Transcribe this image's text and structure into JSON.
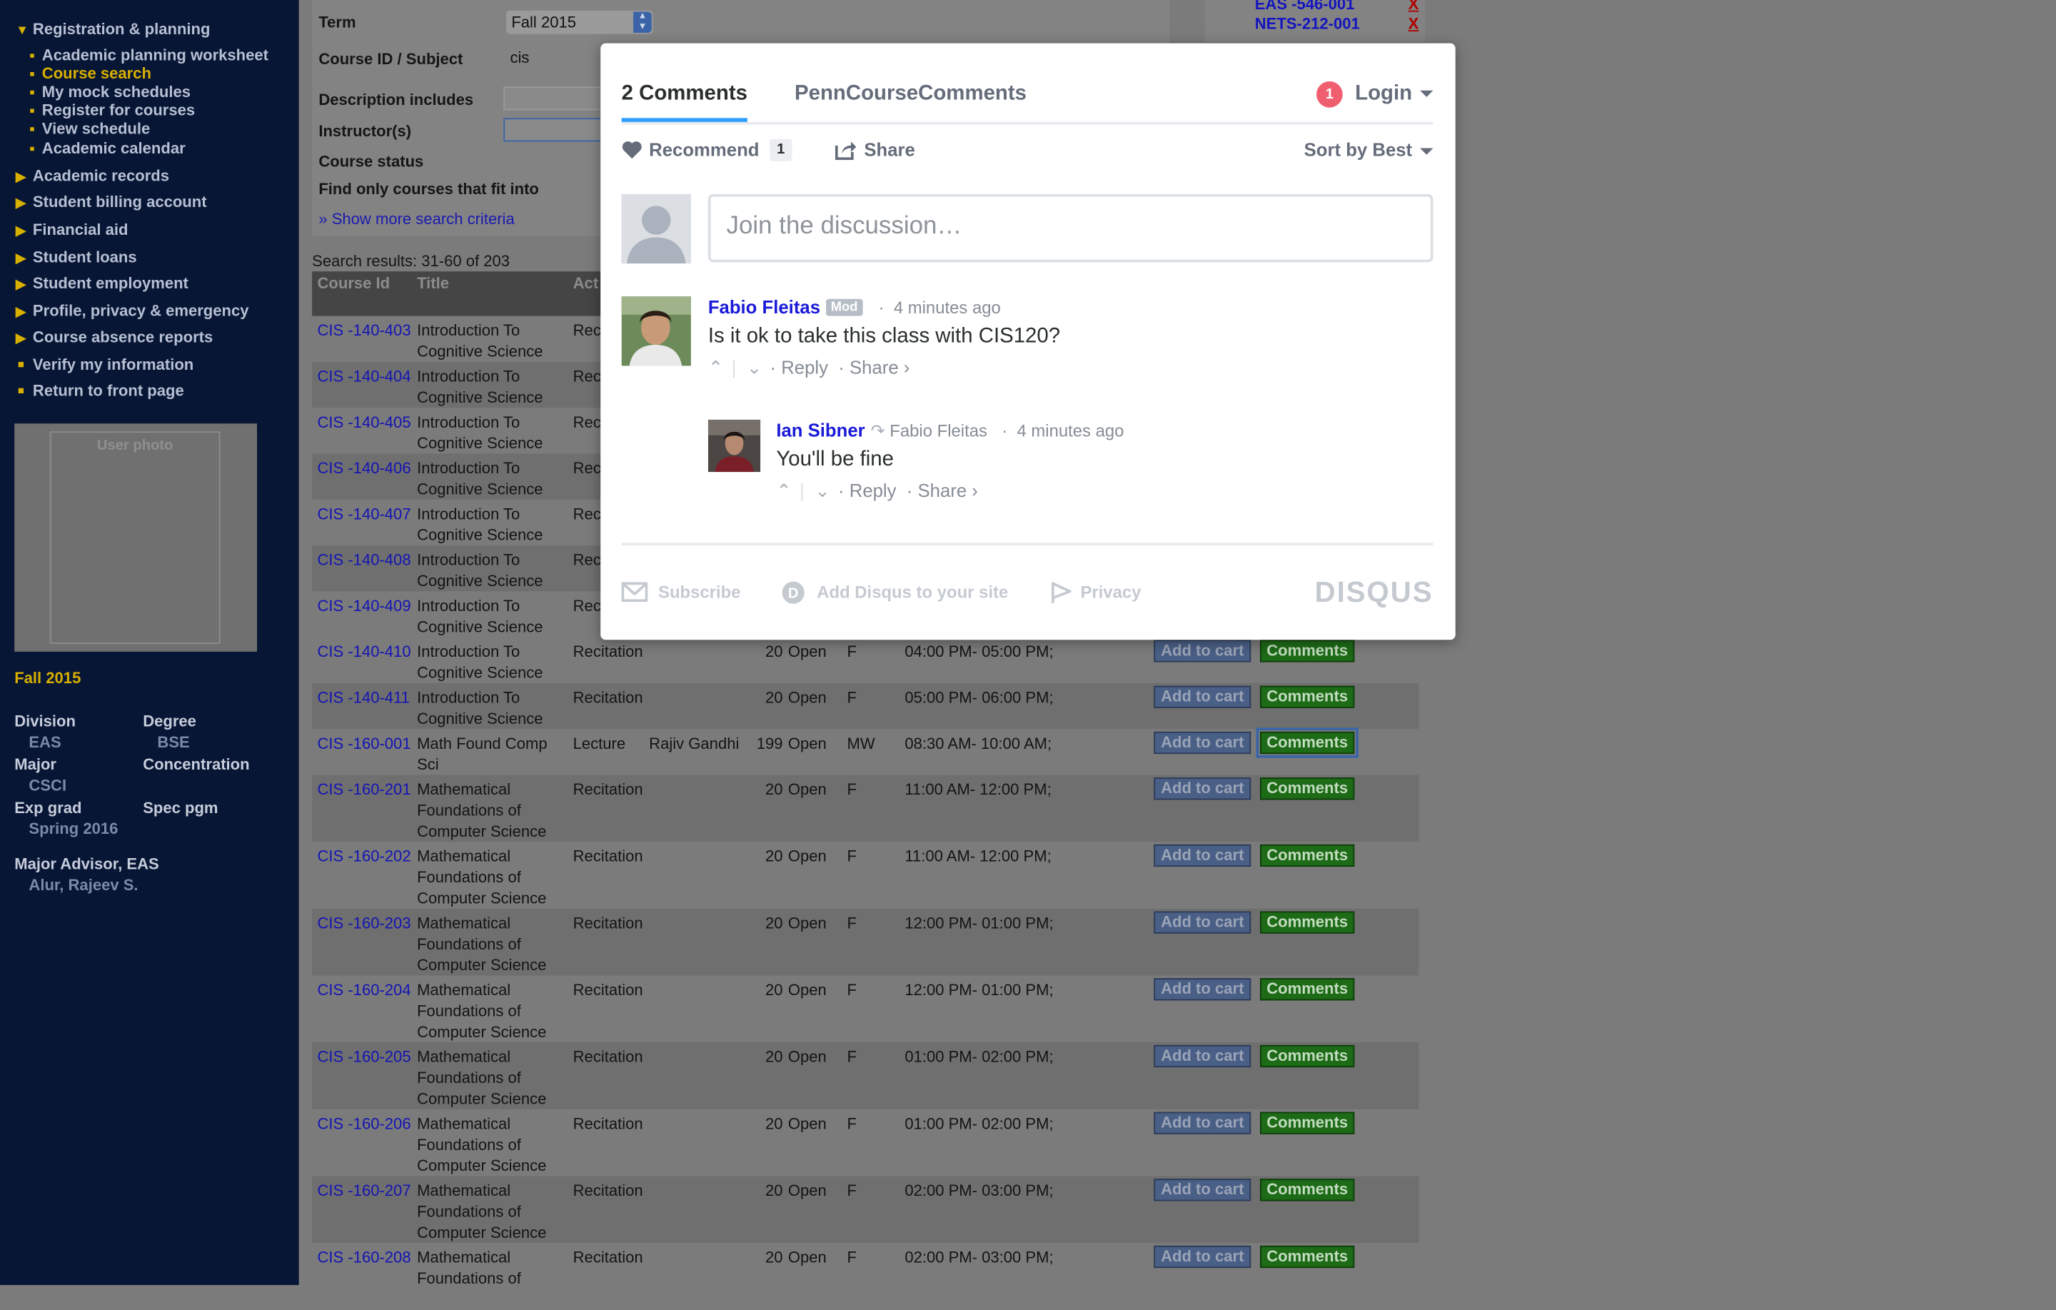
{
  "sidebar": {
    "section_open": "Registration & planning",
    "sub_items": [
      {
        "label": "Academic planning worksheet",
        "active": false
      },
      {
        "label": "Course search",
        "active": true
      },
      {
        "label": "My mock schedules",
        "active": false
      },
      {
        "label": "Register for courses",
        "active": false
      },
      {
        "label": "View schedule",
        "active": false
      },
      {
        "label": "Academic calendar",
        "active": false
      }
    ],
    "sections": [
      {
        "label": "Academic records",
        "marker": "triangle"
      },
      {
        "label": "Student billing account",
        "marker": "triangle"
      },
      {
        "label": "Financial aid",
        "marker": "triangle"
      },
      {
        "label": "Student loans",
        "marker": "triangle"
      },
      {
        "label": "Student employment",
        "marker": "triangle"
      },
      {
        "label": "Profile, privacy & emergency",
        "marker": "triangle"
      },
      {
        "label": "Course absence reports",
        "marker": "triangle"
      },
      {
        "label": "Verify my information",
        "marker": "square"
      },
      {
        "label": "Return to front page",
        "marker": "square"
      }
    ],
    "photo_label": "User photo",
    "semester": "Fall 2015",
    "info": {
      "division_label": "Division",
      "division": "EAS",
      "degree_label": "Degree",
      "degree": "BSE",
      "major_label": "Major",
      "major": "CSCI",
      "concentration_label": "Concentration",
      "exp_grad_label": "Exp grad",
      "exp_grad": "Spring 2016",
      "spec_pgm_label": "Spec pgm",
      "advisor_label": "Major Advisor, EAS",
      "advisor": "Alur, Rajeev S."
    }
  },
  "search_form": {
    "term_label": "Term",
    "term_value": "Fall 2015",
    "course_id_label": "Course ID / Subject",
    "course_id_value": "cis",
    "description_label": "Description includes",
    "instructor_label": "Instructor(s)",
    "status_label": "Course status",
    "fit_label": "Find only courses that fit into",
    "show_more": "» Show more search criteria"
  },
  "cart": [
    {
      "course": "EAS -546-001",
      "remove": "X"
    },
    {
      "course": "NETS-212-001",
      "remove": "X"
    }
  ],
  "results": {
    "summary": "Search results: 31-60 of 203",
    "headers": {
      "course_id": "Course Id",
      "title": "Title",
      "activity": "Act"
    },
    "add_label": "Add to cart",
    "comments_label": "Comments",
    "rows": [
      {
        "id": "CIS -140-403",
        "title": "Introduction To Cognitive Science",
        "activity": "Reci",
        "instructor": "",
        "max": "",
        "status": "",
        "days": "",
        "time": ""
      },
      {
        "id": "CIS -140-404",
        "title": "Introduction To Cognitive Science",
        "activity": "Reci",
        "instructor": "",
        "max": "",
        "status": "",
        "days": "",
        "time": ""
      },
      {
        "id": "CIS -140-405",
        "title": "Introduction To Cognitive Science",
        "activity": "Reci",
        "instructor": "",
        "max": "",
        "status": "",
        "days": "",
        "time": ""
      },
      {
        "id": "CIS -140-406",
        "title": "Introduction To Cognitive Science",
        "activity": "Reci",
        "instructor": "",
        "max": "",
        "status": "",
        "days": "",
        "time": ""
      },
      {
        "id": "CIS -140-407",
        "title": "Introduction To Cognitive Science",
        "activity": "Reci",
        "instructor": "",
        "max": "",
        "status": "",
        "days": "",
        "time": ""
      },
      {
        "id": "CIS -140-408",
        "title": "Introduction To Cognitive Science",
        "activity": "Reci",
        "instructor": "",
        "max": "",
        "status": "",
        "days": "",
        "time": ""
      },
      {
        "id": "CIS -140-409",
        "title": "Introduction To Cognitive Science",
        "activity": "Reci",
        "instructor": "",
        "max": "",
        "status": "",
        "days": "",
        "time": ""
      },
      {
        "id": "CIS -140-410",
        "title": "Introduction To Cognitive Science",
        "activity": "Recitation",
        "instructor": "",
        "max": "20",
        "status": "Open",
        "days": "F",
        "time": "04:00 PM- 05:00 PM;"
      },
      {
        "id": "CIS -140-411",
        "title": "Introduction To Cognitive Science",
        "activity": "Recitation",
        "instructor": "",
        "max": "20",
        "status": "Open",
        "days": "F",
        "time": "05:00 PM- 06:00 PM;"
      },
      {
        "id": "CIS -160-001",
        "title": "Math Found Comp Sci",
        "activity": "Lecture",
        "instructor": "Rajiv Gandhi",
        "max": "199",
        "status": "Open",
        "days": "MW",
        "time": "08:30 AM- 10:00 AM;"
      },
      {
        "id": "CIS -160-201",
        "title": "Mathematical Foundations of Computer Science",
        "activity": "Recitation",
        "instructor": "",
        "max": "20",
        "status": "Open",
        "days": "F",
        "time": "11:00 AM- 12:00 PM;"
      },
      {
        "id": "CIS -160-202",
        "title": "Mathematical Foundations of Computer Science",
        "activity": "Recitation",
        "instructor": "",
        "max": "20",
        "status": "Open",
        "days": "F",
        "time": "11:00 AM- 12:00 PM;"
      },
      {
        "id": "CIS -160-203",
        "title": "Mathematical Foundations of Computer Science",
        "activity": "Recitation",
        "instructor": "",
        "max": "20",
        "status": "Open",
        "days": "F",
        "time": "12:00 PM- 01:00 PM;"
      },
      {
        "id": "CIS -160-204",
        "title": "Mathematical Foundations of Computer Science",
        "activity": "Recitation",
        "instructor": "",
        "max": "20",
        "status": "Open",
        "days": "F",
        "time": "12:00 PM- 01:00 PM;"
      },
      {
        "id": "CIS -160-205",
        "title": "Mathematical Foundations of Computer Science",
        "activity": "Recitation",
        "instructor": "",
        "max": "20",
        "status": "Open",
        "days": "F",
        "time": "01:00 PM- 02:00 PM;"
      },
      {
        "id": "CIS -160-206",
        "title": "Mathematical Foundations of Computer Science",
        "activity": "Recitation",
        "instructor": "",
        "max": "20",
        "status": "Open",
        "days": "F",
        "time": "01:00 PM- 02:00 PM;"
      },
      {
        "id": "CIS -160-207",
        "title": "Mathematical Foundations of Computer Science",
        "activity": "Recitation",
        "instructor": "",
        "max": "20",
        "status": "Open",
        "days": "F",
        "time": "02:00 PM- 03:00 PM;"
      },
      {
        "id": "CIS -160-208",
        "title": "Mathematical Foundations of",
        "activity": "Recitation",
        "instructor": "",
        "max": "20",
        "status": "Open",
        "days": "F",
        "time": "02:00 PM- 03:00 PM;"
      }
    ]
  },
  "disqus": {
    "tab_comments": "2 Comments",
    "tab_forum": "PennCourseComments",
    "notification_count": "1",
    "login_label": "Login",
    "recommend_label": "Recommend",
    "recommend_count": "1",
    "share_label": "Share",
    "sort_label": "Sort by Best",
    "composer_placeholder": "Join the discussion…",
    "comments": [
      {
        "author": "Fabio Fleitas",
        "badge": "Mod",
        "time": "4 minutes ago",
        "body": "Is it ok to take this class with CIS120?",
        "reply": "Reply",
        "share": "Share ›"
      },
      {
        "author": "Ian Sibner",
        "reply_to": "Fabio Fleitas",
        "time": "4 minutes ago",
        "body": "You'll be fine",
        "reply": "Reply",
        "share": "Share ›"
      }
    ],
    "footer": {
      "subscribe": "Subscribe",
      "add_disqus": "Add Disqus to your site",
      "privacy": "Privacy",
      "logo": "DISQUS"
    }
  }
}
